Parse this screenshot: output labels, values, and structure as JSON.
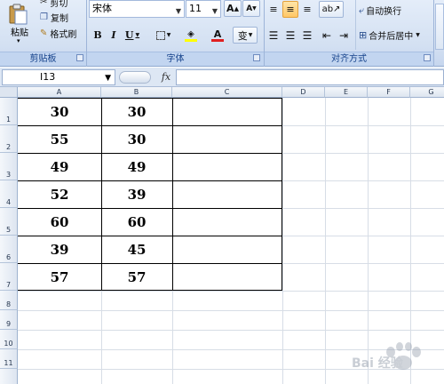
{
  "ribbon": {
    "clipboard": {
      "paste_label": "粘贴",
      "cut_label": "剪切",
      "copy_label": "复制",
      "format_painter_label": "格式刷",
      "group_label": "剪贴板"
    },
    "font": {
      "font_name": "宋体",
      "font_size": "11",
      "grow_label": "A",
      "shrink_label": "A",
      "bold_label": "B",
      "italic_label": "I",
      "underline_label": "U",
      "phonetic_label": "变",
      "group_label": "字体"
    },
    "alignment": {
      "wrap_text_label": "自动换行",
      "merge_center_label": "合并后居中",
      "group_label": "对齐方式"
    }
  },
  "formula_bar": {
    "name_box": "I13",
    "fx_label": "fx",
    "formula": ""
  },
  "grid": {
    "columns": [
      "A",
      "B",
      "C",
      "D",
      "E",
      "F",
      "G"
    ],
    "rows": [
      "1",
      "2",
      "3",
      "4",
      "5",
      "6",
      "7",
      "8",
      "9",
      "10",
      "11"
    ],
    "cells": [
      [
        "30",
        "30"
      ],
      [
        "55",
        "30"
      ],
      [
        "49",
        "49"
      ],
      [
        "52",
        "39"
      ],
      [
        "60",
        "60"
      ],
      [
        "39",
        "45"
      ],
      [
        "57",
        "57"
      ]
    ]
  },
  "watermark": {
    "text": "Bai 经验"
  },
  "colors": {
    "ribbon_bg": "#d3e0f2",
    "group_label_text": "#15428b",
    "font_color_accent": "#e02020",
    "highlight_accent": "#ffff00"
  }
}
